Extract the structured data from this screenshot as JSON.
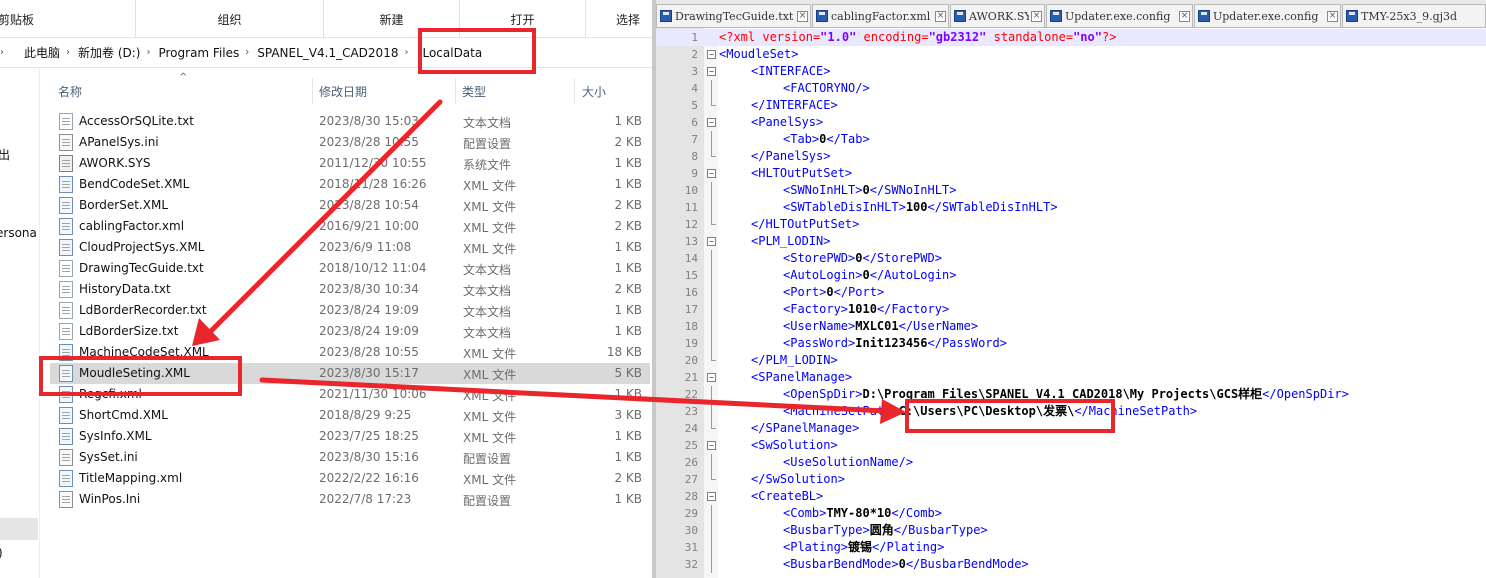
{
  "explorer": {
    "ribbon": [
      "剪贴板",
      "组织",
      "新建",
      "打开",
      "选择"
    ],
    "breadcrumb": [
      "此电脑",
      "新加卷 (D:)",
      "Program Files",
      "SPANEL_V4.1_CAD2018",
      "LocalData"
    ],
    "nav_items": [
      "出",
      "ersona",
      ")"
    ],
    "columns": {
      "name": "名称",
      "date": "修改日期",
      "type": "类型",
      "size": "大小"
    },
    "files": [
      {
        "name": "AccessOrSQLite.txt",
        "date": "2023/8/30 15:03",
        "type": "文本文档",
        "size": "1 KB",
        "icon": "text-file-icon"
      },
      {
        "name": "APanelSys.ini",
        "date": "2023/8/28 10:55",
        "type": "配置设置",
        "size": "2 KB",
        "icon": "ini-file-icon"
      },
      {
        "name": "AWORK.SYS",
        "date": "2011/12/30 10:55",
        "type": "系统文件",
        "size": "1 KB",
        "icon": "sys-file-icon"
      },
      {
        "name": "BendCodeSet.XML",
        "date": "2018/11/28 16:26",
        "type": "XML 文件",
        "size": "1 KB",
        "icon": "xml-file-icon"
      },
      {
        "name": "BorderSet.XML",
        "date": "2023/8/28 10:54",
        "type": "XML 文件",
        "size": "2 KB",
        "icon": "xml-file-icon"
      },
      {
        "name": "cablingFactor.xml",
        "date": "2016/9/21 10:00",
        "type": "XML 文件",
        "size": "2 KB",
        "icon": "xml-file-icon"
      },
      {
        "name": "CloudProjectSys.XML",
        "date": "2023/6/9 11:08",
        "type": "XML 文件",
        "size": "1 KB",
        "icon": "xml-file-icon"
      },
      {
        "name": "DrawingTecGuide.txt",
        "date": "2018/10/12 11:04",
        "type": "文本文档",
        "size": "1 KB",
        "icon": "text-file-icon"
      },
      {
        "name": "HistoryData.txt",
        "date": "2023/8/30 10:34",
        "type": "文本文档",
        "size": "2 KB",
        "icon": "text-file-icon"
      },
      {
        "name": "LdBorderRecorder.txt",
        "date": "2023/8/24 19:09",
        "type": "文本文档",
        "size": "1 KB",
        "icon": "text-file-icon"
      },
      {
        "name": "LdBorderSize.txt",
        "date": "2023/8/24 19:09",
        "type": "文本文档",
        "size": "1 KB",
        "icon": "text-file-icon"
      },
      {
        "name": "MachineCodeSet.XML",
        "date": "2023/8/28 10:55",
        "type": "XML 文件",
        "size": "18 KB",
        "icon": "xml-file-icon"
      },
      {
        "name": "MoudleSeting.XML",
        "date": "2023/8/30 15:17",
        "type": "XML 文件",
        "size": "5 KB",
        "icon": "xml-file-icon",
        "selected": true
      },
      {
        "name": "Regcfi.xml",
        "date": "2021/11/30 10:06",
        "type": "XML 文件",
        "size": "1 KB",
        "icon": "xml-file-icon"
      },
      {
        "name": "ShortCmd.XML",
        "date": "2018/8/29 9:25",
        "type": "XML 文件",
        "size": "3 KB",
        "icon": "xml-file-icon"
      },
      {
        "name": "SysInfo.XML",
        "date": "2023/7/25 18:25",
        "type": "XML 文件",
        "size": "1 KB",
        "icon": "xml-file-icon"
      },
      {
        "name": "SysSet.ini",
        "date": "2023/8/30 15:16",
        "type": "配置设置",
        "size": "1 KB",
        "icon": "ini-file-icon"
      },
      {
        "name": "TitleMapping.xml",
        "date": "2022/2/22 16:16",
        "type": "XML 文件",
        "size": "2 KB",
        "icon": "xml-file-icon"
      },
      {
        "name": "WinPos.Ini",
        "date": "2022/7/8 17:23",
        "type": "配置设置",
        "size": "1 KB",
        "icon": "ini-file-icon"
      }
    ]
  },
  "editor": {
    "tabs": [
      "DrawingTecGuide.txt",
      "cablingFactor.xml",
      "AWORK.SYS",
      "Updater.exe.config",
      "Updater.exe.config",
      "TMY-25x3_9.gj3d"
    ],
    "tab_close_glyph": "×",
    "fold_open_glyph": "−",
    "lines": [
      {
        "n": "1",
        "indent": 0,
        "fold": "none",
        "parts": [
          [
            "pi",
            "<?xml "
          ],
          [
            "attr",
            "version"
          ],
          [
            "pi",
            "="
          ],
          [
            "str",
            "\"1.0\""
          ],
          [
            "pi",
            " "
          ],
          [
            "attr",
            "encoding"
          ],
          [
            "pi",
            "="
          ],
          [
            "str",
            "\"gb2312\""
          ],
          [
            "pi",
            " "
          ],
          [
            "attr",
            "standalone"
          ],
          [
            "pi",
            "="
          ],
          [
            "str",
            "\"no\""
          ],
          [
            "pi",
            "?>"
          ]
        ],
        "current": true
      },
      {
        "n": "2",
        "indent": 0,
        "fold": "open",
        "parts": [
          [
            "tag",
            "<MoudleSet>"
          ]
        ]
      },
      {
        "n": "3",
        "indent": 1,
        "fold": "open",
        "parts": [
          [
            "tag",
            "<INTERFACE>"
          ]
        ]
      },
      {
        "n": "4",
        "indent": 2,
        "fold": "line",
        "parts": [
          [
            "tag",
            "<FACTORYNO/>"
          ]
        ]
      },
      {
        "n": "5",
        "indent": 1,
        "fold": "end",
        "parts": [
          [
            "tag",
            "</INTERFACE>"
          ]
        ]
      },
      {
        "n": "6",
        "indent": 1,
        "fold": "open",
        "parts": [
          [
            "tag",
            "<PanelSys>"
          ]
        ]
      },
      {
        "n": "7",
        "indent": 2,
        "fold": "line",
        "parts": [
          [
            "tag",
            "<Tab>"
          ],
          [
            "val",
            "0"
          ],
          [
            "tag",
            "</Tab>"
          ]
        ]
      },
      {
        "n": "8",
        "indent": 1,
        "fold": "end",
        "parts": [
          [
            "tag",
            "</PanelSys>"
          ]
        ]
      },
      {
        "n": "9",
        "indent": 1,
        "fold": "open",
        "parts": [
          [
            "tag",
            "<HLTOutPutSet>"
          ]
        ]
      },
      {
        "n": "10",
        "indent": 2,
        "fold": "line",
        "parts": [
          [
            "tag",
            "<SWNoInHLT>"
          ],
          [
            "val",
            "0"
          ],
          [
            "tag",
            "</SWNoInHLT>"
          ]
        ]
      },
      {
        "n": "11",
        "indent": 2,
        "fold": "line",
        "parts": [
          [
            "tag",
            "<SWTableDisInHLT>"
          ],
          [
            "val",
            "100"
          ],
          [
            "tag",
            "</SWTableDisInHLT>"
          ]
        ]
      },
      {
        "n": "12",
        "indent": 1,
        "fold": "end",
        "parts": [
          [
            "tag",
            "</HLTOutPutSet>"
          ]
        ]
      },
      {
        "n": "13",
        "indent": 1,
        "fold": "open",
        "parts": [
          [
            "tag",
            "<PLM_LODIN>"
          ]
        ]
      },
      {
        "n": "14",
        "indent": 2,
        "fold": "line",
        "parts": [
          [
            "tag",
            "<StorePWD>"
          ],
          [
            "val",
            "0"
          ],
          [
            "tag",
            "</StorePWD>"
          ]
        ]
      },
      {
        "n": "15",
        "indent": 2,
        "fold": "line",
        "parts": [
          [
            "tag",
            "<AutoLogin>"
          ],
          [
            "val",
            "0"
          ],
          [
            "tag",
            "</AutoLogin>"
          ]
        ]
      },
      {
        "n": "16",
        "indent": 2,
        "fold": "line",
        "parts": [
          [
            "tag",
            "<Port>"
          ],
          [
            "val",
            "0"
          ],
          [
            "tag",
            "</Port>"
          ]
        ]
      },
      {
        "n": "17",
        "indent": 2,
        "fold": "line",
        "parts": [
          [
            "tag",
            "<Factory>"
          ],
          [
            "val",
            "1010"
          ],
          [
            "tag",
            "</Factory>"
          ]
        ]
      },
      {
        "n": "18",
        "indent": 2,
        "fold": "line",
        "parts": [
          [
            "tag",
            "<UserName>"
          ],
          [
            "val",
            "MXLC01"
          ],
          [
            "tag",
            "</UserName>"
          ]
        ]
      },
      {
        "n": "19",
        "indent": 2,
        "fold": "line",
        "parts": [
          [
            "tag",
            "<PassWord>"
          ],
          [
            "val",
            "Init123456"
          ],
          [
            "tag",
            "</PassWord>"
          ]
        ]
      },
      {
        "n": "20",
        "indent": 1,
        "fold": "end",
        "parts": [
          [
            "tag",
            "</PLM_LODIN>"
          ]
        ]
      },
      {
        "n": "21",
        "indent": 1,
        "fold": "open",
        "parts": [
          [
            "tag",
            "<SPanelManage>"
          ]
        ]
      },
      {
        "n": "22",
        "indent": 2,
        "fold": "line",
        "parts": [
          [
            "tag",
            "<OpenSpDir>"
          ],
          [
            "val",
            "D:\\Program Files\\SPANEL_V4.1_CAD2018\\My Projects\\GCS样柜"
          ],
          [
            "tag",
            "</OpenSpDir>"
          ]
        ]
      },
      {
        "n": "23",
        "indent": 2,
        "fold": "line",
        "parts": [
          [
            "tag",
            "<MachineSetPath>"
          ],
          [
            "val",
            "C:\\Users\\PC\\Desktop\\发票\\"
          ],
          [
            "tag",
            "</MachineSetPath>"
          ]
        ]
      },
      {
        "n": "24",
        "indent": 1,
        "fold": "end",
        "parts": [
          [
            "tag",
            "</SPanelManage>"
          ]
        ]
      },
      {
        "n": "25",
        "indent": 1,
        "fold": "open",
        "parts": [
          [
            "tag",
            "<SwSolution>"
          ]
        ]
      },
      {
        "n": "26",
        "indent": 2,
        "fold": "line",
        "parts": [
          [
            "tag",
            "<UseSolutionName/>"
          ]
        ]
      },
      {
        "n": "27",
        "indent": 1,
        "fold": "end",
        "parts": [
          [
            "tag",
            "</SwSolution>"
          ]
        ]
      },
      {
        "n": "28",
        "indent": 1,
        "fold": "open",
        "parts": [
          [
            "tag",
            "<CreateBL>"
          ]
        ]
      },
      {
        "n": "29",
        "indent": 2,
        "fold": "line",
        "parts": [
          [
            "tag",
            "<Comb>"
          ],
          [
            "val",
            "TMY-80*10"
          ],
          [
            "tag",
            "</Comb>"
          ]
        ]
      },
      {
        "n": "30",
        "indent": 2,
        "fold": "line",
        "parts": [
          [
            "tag",
            "<BusbarType>"
          ],
          [
            "val",
            "圆角"
          ],
          [
            "tag",
            "</BusbarType>"
          ]
        ]
      },
      {
        "n": "31",
        "indent": 2,
        "fold": "line",
        "parts": [
          [
            "tag",
            "<Plating>"
          ],
          [
            "val",
            "镀锡"
          ],
          [
            "tag",
            "</Plating>"
          ]
        ]
      },
      {
        "n": "32",
        "indent": 2,
        "fold": "line",
        "parts": [
          [
            "tag",
            "<BusbarBendMode>"
          ],
          [
            "val",
            "0"
          ],
          [
            "tag",
            "</BusbarBendMode>"
          ]
        ]
      }
    ]
  },
  "annotation_color": "#e8262b"
}
